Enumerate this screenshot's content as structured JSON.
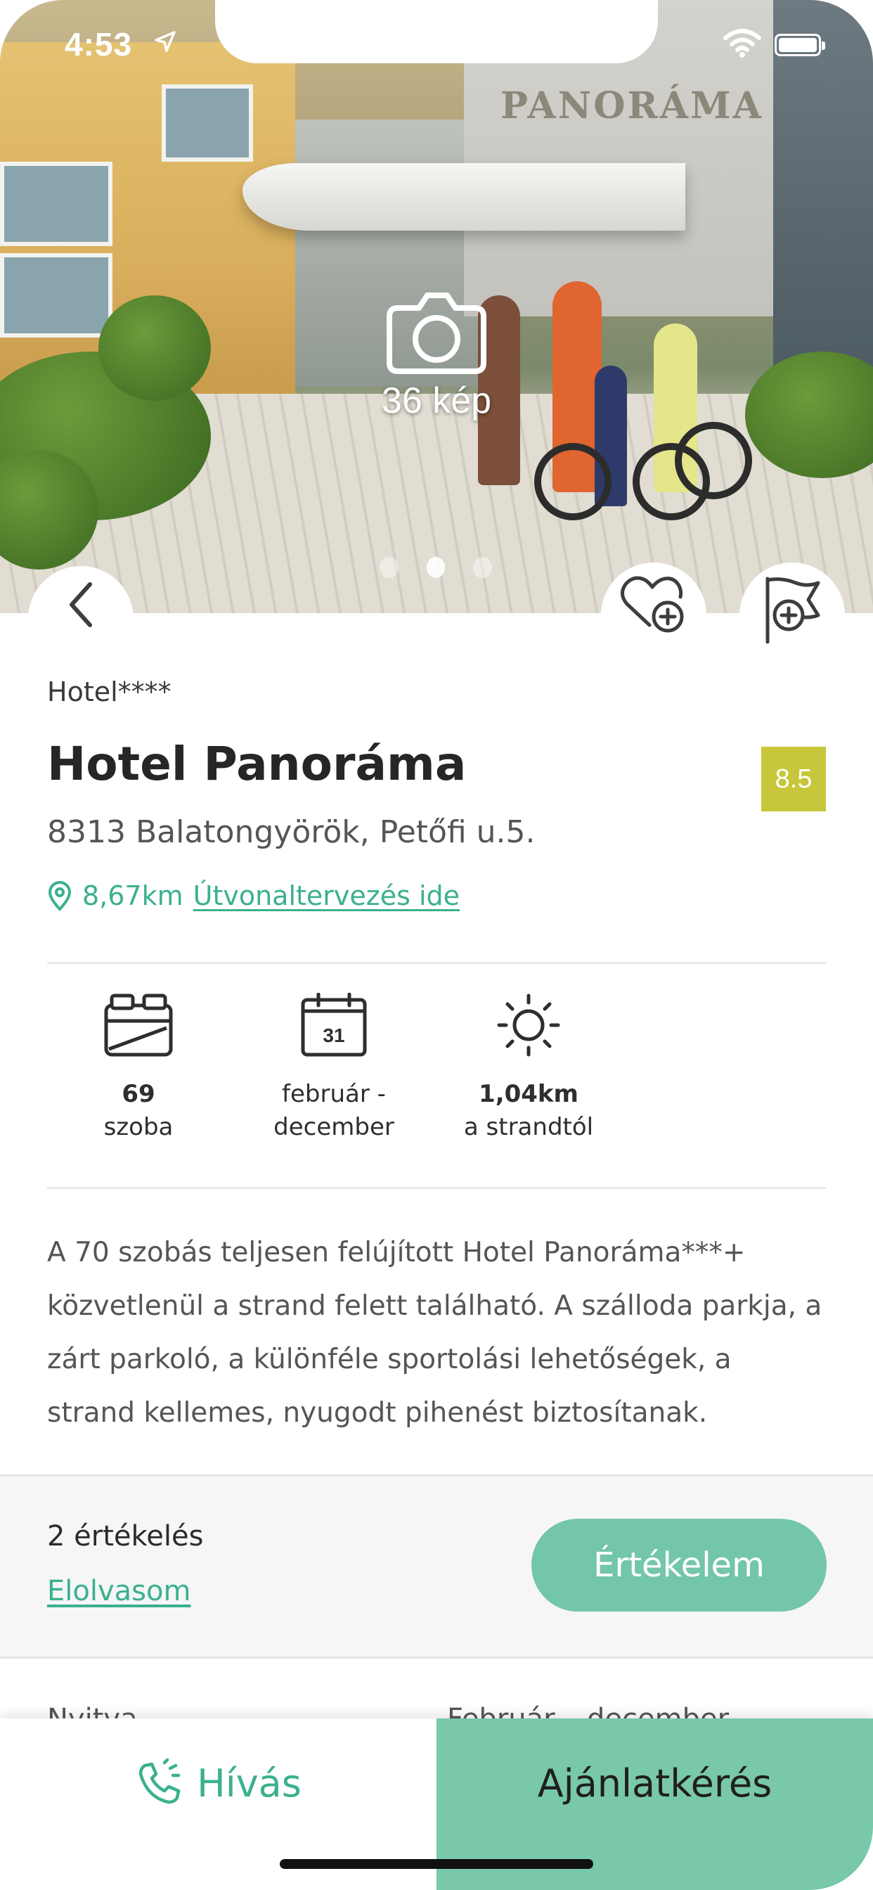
{
  "status_bar": {
    "time": "4:53"
  },
  "gallery": {
    "photo_count_label": "36 kép",
    "slide_count": 3,
    "active_slide": 2,
    "sign_text": "PANORÁMA"
  },
  "hotel": {
    "category": "Hotel****",
    "name": "Hotel Panoráma",
    "rating": "8.5",
    "address": "8313 Balatongyörök, Petőfi u.5.",
    "distance": "8,67km",
    "route_link": "Útvonaltervezés ide"
  },
  "features": [
    {
      "icon": "room-bed-icon",
      "main": "69",
      "sub": "szoba"
    },
    {
      "icon": "calendar-icon",
      "icon_text": "31",
      "main": "február -",
      "sub": "december"
    },
    {
      "icon": "sun-icon",
      "main": "1,04km",
      "sub": "a strandtól"
    }
  ],
  "description": "A 70 szobás teljesen felújított Hotel Panoráma***+ közvetlenül a strand felett található. A szálloda parkja, a zárt parkoló, a különféle sportolási lehetőségek, a strand kellemes, nyugodt pihenést biztosítanak.",
  "reviews": {
    "count_label": "2 értékelés",
    "read_link": "Elolvasom",
    "rate_button": "Értékelem"
  },
  "info_row": {
    "label": "Nyitva",
    "value": "Február – december"
  },
  "bottom_bar": {
    "call_label": "Hívás",
    "offer_label": "Ajánlatkérés"
  },
  "colors": {
    "accent": "#3bb08f",
    "button_green": "#73c6a8",
    "rating_badge": "#c8c63a"
  }
}
